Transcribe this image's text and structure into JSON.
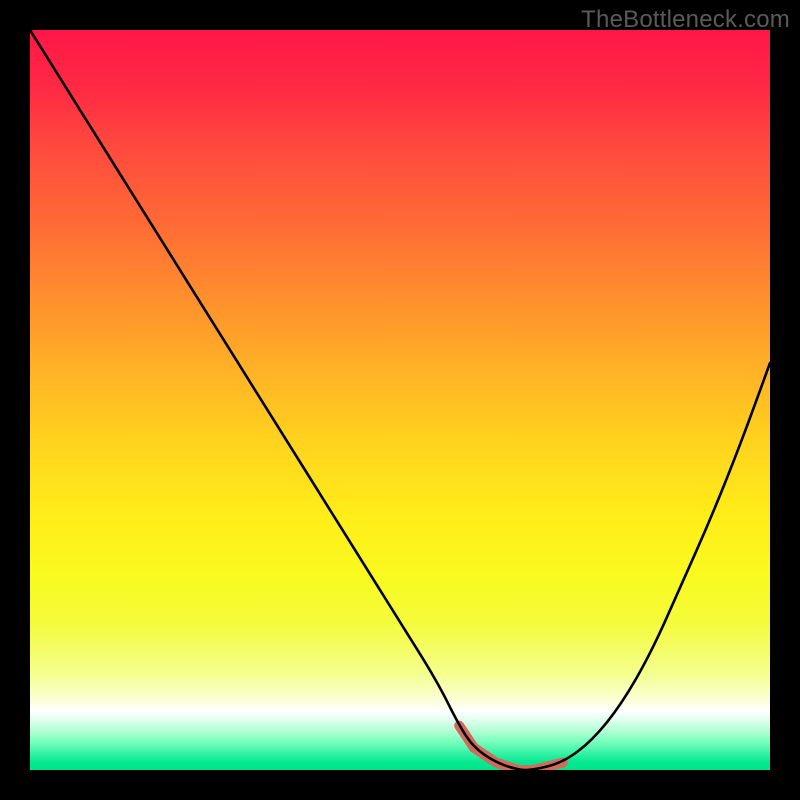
{
  "watermark": "TheBottleneck.com",
  "chart_data": {
    "type": "line",
    "title": "",
    "xlabel": "",
    "ylabel": "",
    "xlim": [
      0,
      100
    ],
    "ylim": [
      0,
      100
    ],
    "grid": false,
    "legend": false,
    "series": [
      {
        "name": "bottleneck-curve",
        "x": [
          0,
          5,
          10,
          15,
          20,
          25,
          30,
          35,
          40,
          45,
          50,
          55,
          58,
          60,
          63,
          66,
          68,
          72,
          76,
          80,
          84,
          88,
          92,
          96,
          100
        ],
        "y": [
          100,
          92,
          84,
          76,
          68,
          60,
          52,
          44,
          36,
          28,
          20,
          12,
          6,
          3,
          1,
          0,
          0,
          1,
          4,
          9,
          16,
          25,
          34,
          44,
          55
        ]
      }
    ],
    "highlight_range_x": [
      58,
      72
    ],
    "background_gradient": {
      "top": "#ff1648",
      "mid": "#ffee18",
      "bottom": "#00e58a"
    }
  }
}
